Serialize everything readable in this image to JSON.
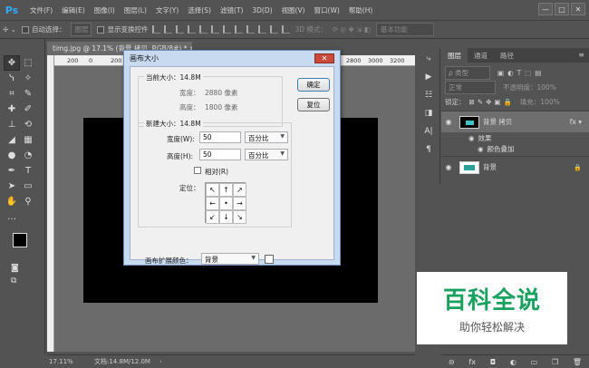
{
  "app": {
    "logo": "Ps",
    "menu": [
      "文件(F)",
      "编辑(E)",
      "图像(I)",
      "图层(L)",
      "文字(Y)",
      "选择(S)",
      "滤镜(T)",
      "3D(D)",
      "视图(V)",
      "窗口(W)",
      "帮助(H)"
    ],
    "window_controls": [
      "—",
      "□",
      "✕"
    ]
  },
  "options_bar": {
    "auto_select_label": "自动选择：",
    "auto_select_target": "图层",
    "transform_controls_label": "显示变换控件",
    "mode_3d_label": "3D 模式：",
    "workspace": "基本功能"
  },
  "document": {
    "tab_title": "timg.jpg @ 17.1% (背景 拷贝, RGB/8#) * ✕",
    "ruler_ticks": [
      "200",
      "0",
      "200",
      "400",
      "2600",
      "2800",
      "3000",
      "3200"
    ],
    "zoom": "17.11%",
    "doc_size": "文档:14.8M/12.0M"
  },
  "dialog": {
    "title": "画布大小",
    "close_label": "✕",
    "current_size_label": "当前大小：14.8M",
    "current_width_label": "宽度：",
    "current_width_value": "2880 像素",
    "current_height_label": "高度：",
    "current_height_value": "1800 像素",
    "new_size_label": "新建大小：14.8M",
    "width_label": "宽度(W):",
    "width_value": "50",
    "width_unit": "百分比",
    "height_label": "高度(H):",
    "height_value": "50",
    "height_unit": "百分比",
    "relative_label": "相对(R)",
    "anchor_label": "定位：",
    "anchor_arrows": [
      "↖",
      "↑",
      "↗",
      "←",
      "•",
      "→",
      "↙",
      "↓",
      "↘"
    ],
    "extension_color_label": "画布扩展颜色：",
    "extension_color_value": "背景",
    "ok_label": "确定",
    "reset_label": "复位"
  },
  "layers_panel": {
    "tabs": [
      "图层",
      "通道",
      "路径"
    ],
    "filter_kind": "ρ 类型",
    "blend_mode": "正常",
    "opacity_label": "不透明度：",
    "opacity_value": "100%",
    "lock_label": "锁定：",
    "fill_label": "填充：",
    "fill_value": "100%",
    "layers": [
      {
        "name": "背景 拷贝",
        "fx": "fx ▾"
      },
      {
        "name": "背景",
        "lock": "🔒"
      }
    ],
    "effects_label": "效果",
    "color_overlay_label": "颜色叠加",
    "footer_icons": [
      "⊝",
      "fx",
      "◘",
      "◐",
      "▭",
      "❐",
      "🗑"
    ]
  },
  "watermark": {
    "main": "百科全说",
    "sub": "助你轻松解决"
  }
}
